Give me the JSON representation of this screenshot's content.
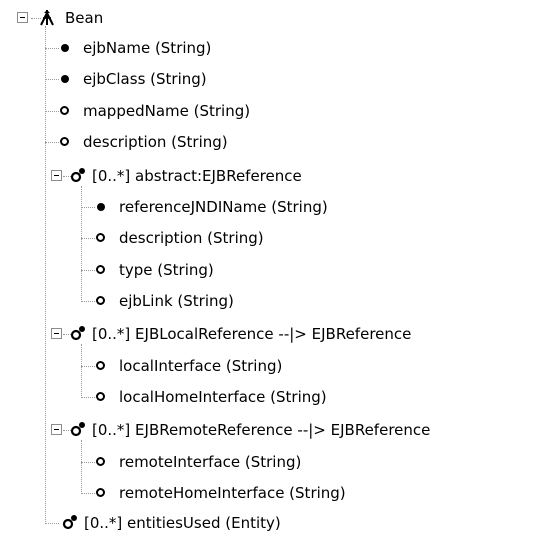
{
  "tree": {
    "root": {
      "label": "Bean",
      "icon": "bean-icon",
      "expanded": true
    },
    "bean_fields": [
      {
        "label": "ejbName (String)",
        "icon": "filled-dot-icon"
      },
      {
        "label": "ejbClass (String)",
        "icon": "filled-dot-icon"
      },
      {
        "label": "mappedName (String)",
        "icon": "hollow-dot-icon"
      },
      {
        "label": "description (String)",
        "icon": "hollow-dot-icon"
      }
    ],
    "ejb_reference": {
      "label": "[0..*] abstract:EJBReference",
      "icon": "multiplicity-icon",
      "expanded": true,
      "children": [
        {
          "label": "referenceJNDIName (String)",
          "icon": "filled-dot-icon"
        },
        {
          "label": "description (String)",
          "icon": "hollow-dot-icon"
        },
        {
          "label": "type (String)",
          "icon": "hollow-dot-icon"
        },
        {
          "label": "ejbLink (String)",
          "icon": "hollow-dot-icon"
        }
      ]
    },
    "ejb_local_reference": {
      "label": "[0..*] EJBLocalReference --|> EJBReference",
      "icon": "multiplicity-icon",
      "expanded": true,
      "children": [
        {
          "label": "localInterface (String)",
          "icon": "hollow-dot-icon"
        },
        {
          "label": "localHomeInterface (String)",
          "icon": "hollow-dot-icon"
        }
      ]
    },
    "ejb_remote_reference": {
      "label": "[0..*] EJBRemoteReference --|> EJBReference",
      "icon": "multiplicity-icon",
      "expanded": true,
      "children": [
        {
          "label": "remoteInterface (String)",
          "icon": "hollow-dot-icon"
        },
        {
          "label": "remoteHomeInterface (String)",
          "icon": "hollow-dot-icon"
        }
      ]
    },
    "entities_used": {
      "label": "[0..*] entitiesUsed (Entity)",
      "icon": "multiplicity-icon"
    }
  },
  "colors": {
    "text": "#000000",
    "connector": "#9a9a9a",
    "expander_border": "#8c8c8c",
    "background": "#ffffff"
  }
}
